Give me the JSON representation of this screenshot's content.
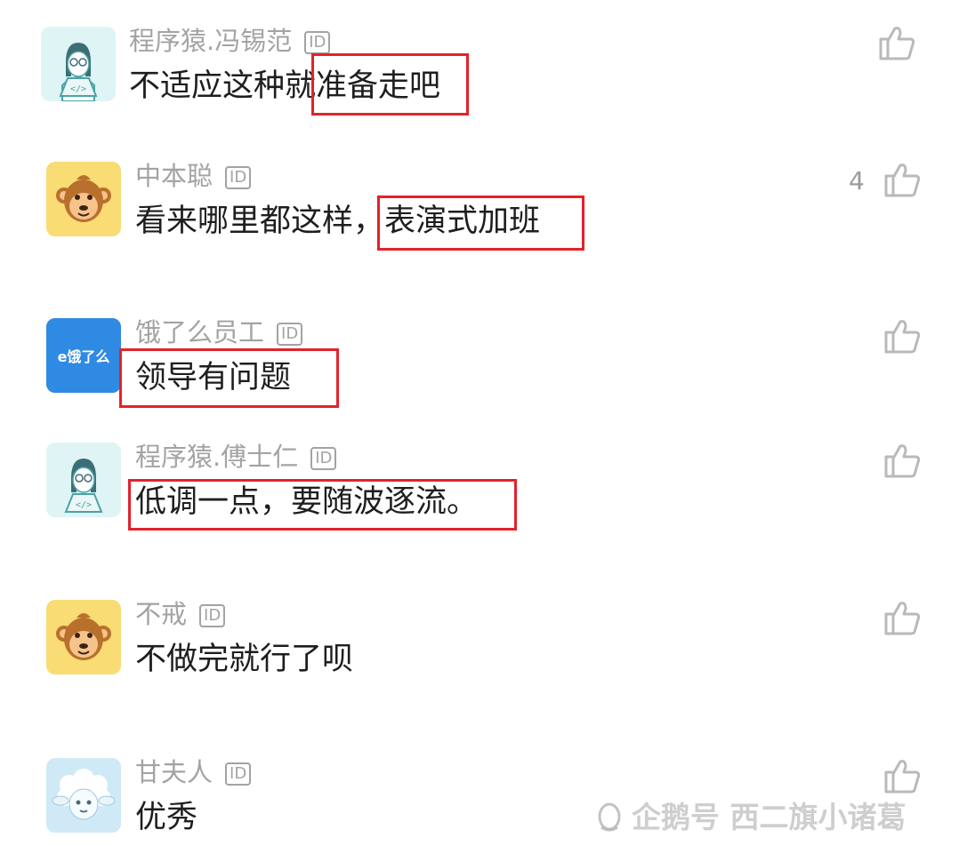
{
  "comments": [
    {
      "username": "程序猿.冯锡范",
      "badge": "ID",
      "text": "不适应这种就准备走吧",
      "likes": "",
      "avatar": "programmer-avatar"
    },
    {
      "username": "中本聪",
      "badge": "ID",
      "text": "看来哪里都这样，表演式加班",
      "likes": "4",
      "avatar": "monkey-avatar"
    },
    {
      "username": "饿了么员工",
      "badge": "ID",
      "text": "领导有问题",
      "likes": "",
      "avatar": "eleme-logo-avatar",
      "avatar_text": "e饿了么"
    },
    {
      "username": "程序猿.傅士仁",
      "badge": "ID",
      "text": "低调一点，要随波逐流。",
      "likes": "",
      "avatar": "programmer-avatar"
    },
    {
      "username": "不戒",
      "badge": "ID",
      "text": "不做完就行了呗",
      "likes": "",
      "avatar": "monkey-avatar"
    },
    {
      "username": "甘夫人",
      "badge": "ID",
      "text": "优秀",
      "likes": "",
      "avatar": "sheep-avatar"
    }
  ],
  "watermark": {
    "text": "企鹅号 西二旗小诸葛",
    "icon": "penguin-icon"
  },
  "colors": {
    "highlight_box": "#e3222b",
    "username": "#a3a3a3",
    "content": "#1e1e1e"
  }
}
